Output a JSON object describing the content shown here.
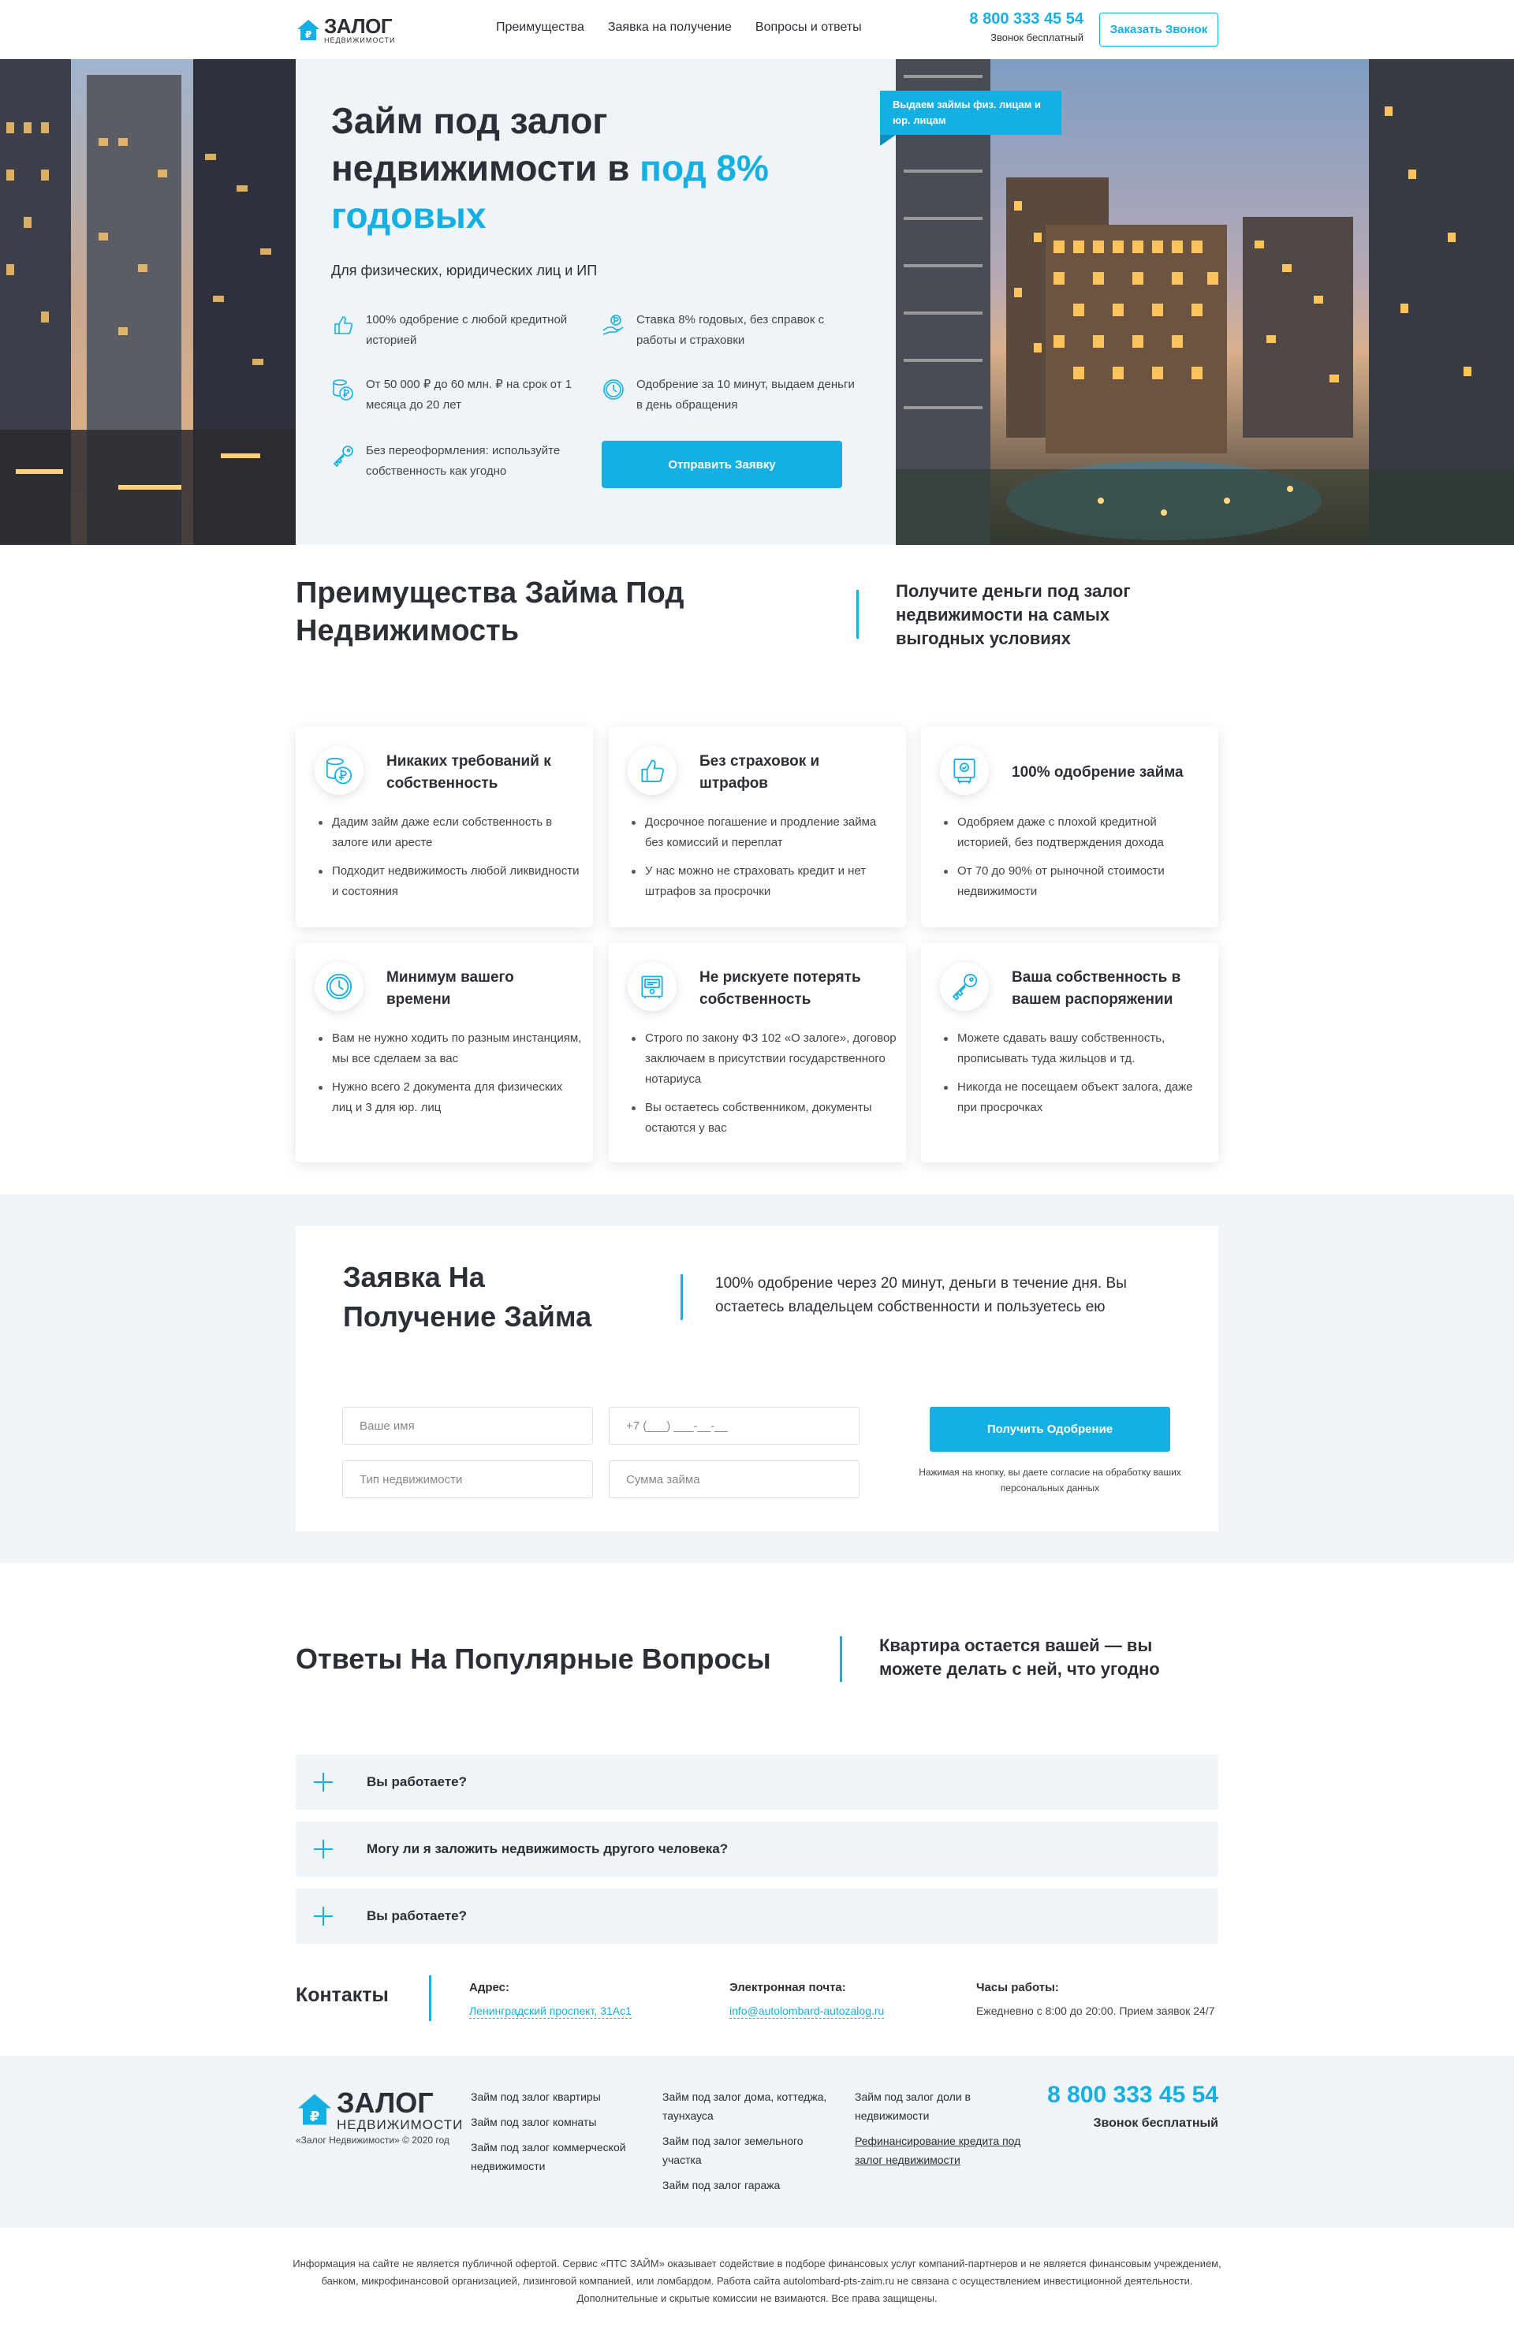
{
  "header": {
    "logo_main": "ЗАЛОГ",
    "logo_sub": "НЕДВИЖИМОСТИ",
    "nav": [
      "Преимущества",
      "Заявка на получение",
      "Вопросы и ответы"
    ],
    "phone": "8 800 333 45 54",
    "phone_note": "Звонок бесплатный",
    "call_button": "Заказать Звонок"
  },
  "hero": {
    "title_plain": "Займ под залог недвижимости в",
    "title_accent": "под 8% годовых",
    "subtitle": "Для физических, юридических лиц и ИП",
    "features": [
      {
        "icon": "thumbs-up-icon",
        "text": "100% одобрение с любой кредитной историей"
      },
      {
        "icon": "hand-coin-icon",
        "text": "Ставка 8% годовых, без справок с работы и страховки"
      },
      {
        "icon": "coins-icon",
        "text": "От 50 000 ₽ до 60 млн. ₽ на срок от 1 месяца до 20 лет"
      },
      {
        "icon": "clock-icon",
        "text": "Одобрение за 10 минут, выдаем деньги в день обращения"
      },
      {
        "icon": "key-icon",
        "text": "Без переоформления: используйте собственность как угодно"
      }
    ],
    "send_button": "Отправить Заявку",
    "flag": "Выдаем займы физ. лицам и юр. лицам"
  },
  "advantages": {
    "title": "Преимущества Займа Под Недвижимость",
    "side": "Получите деньги под залог недвижимости на самых выгодных условиях",
    "cards": [
      {
        "icon": "coins-icon",
        "title": "Никаких требований к собственность",
        "items": [
          "Дадим займ даже если собственность в залоге или аресте",
          "Подходит недвижимость любой ликвидности и состояния"
        ]
      },
      {
        "icon": "thumbs-up-icon",
        "title": "Без страховок и штрафов",
        "items": [
          "Досрочное погашение и продление займа без комиссий и переплат",
          "У нас можно не страховать кредит и нет штрафов за просрочки"
        ]
      },
      {
        "icon": "approved-document-icon",
        "title": "100% одобрение займа",
        "items": [
          "Одобряем даже с плохой кредитной историей, без подтверждения дохода",
          "От 70 до 90% от рыночной стоимости недвижимости"
        ]
      },
      {
        "icon": "clock-icon",
        "title": "Минимум вашего времени",
        "items": [
          "Вам не нужно ходить по разным инстанциям, мы все сделаем за вас",
          "Нужно всего 2 документа для физических лиц и 3 для юр. лиц"
        ]
      },
      {
        "icon": "safe-icon",
        "title": "Не рискуете потерять собственность",
        "items": [
          "Строго по закону ФЗ 102 «О залоге», договор заключаем в присутствии государственного нотариуса",
          "Вы остаетесь собственником, документы остаются у вас"
        ]
      },
      {
        "icon": "key-icon",
        "title": "Ваша собственность в вашем распоряжении",
        "items": [
          "Можете сдавать вашу собственность, прописывать туда жильцов и тд.",
          "Никогда не посещаем объект залога, даже при просрочках"
        ]
      }
    ]
  },
  "form": {
    "title": "Заявка На Получение Займа",
    "side": "100% одобрение через 20 минут, деньги в течение дня. Вы остаетесь владельцем собственности и пользуетесь ею",
    "name_placeholder": "Ваше имя",
    "phone_placeholder": "+7 (___) ___-__-__",
    "type_placeholder": "Тип недвижимости",
    "sum_placeholder": "Сумма займа",
    "submit": "Получить Одобрение",
    "note": "Нажимая на кнопку, вы даете согласие на обработку ваших персональных данных"
  },
  "faq": {
    "title": "Ответы На Популярные Вопросы",
    "side": "Квартира остается вашей — вы можете делать с ней, что угодно",
    "questions": [
      "Вы работаете?",
      "Могу ли я заложить недвижимость другого человека?",
      "Вы работаете?"
    ]
  },
  "contacts": {
    "title": "Контакты",
    "address_label": "Адрес:",
    "address": "Ленинградский проспект, 31Ас1",
    "email_label": "Электронная почта:",
    "email": "info@autolombard-autozalog.ru",
    "hours_label": "Часы работы:",
    "hours": "Ежедневно с 8:00 до 20:00. Прием заявок 24/7"
  },
  "footer": {
    "logo_main": "ЗАЛОГ",
    "logo_sub": "НЕДВИЖИМОСТИ",
    "copyright": "«Залог Недвижимости» © 2020 год",
    "col1": [
      "Займ под залог квартиры",
      "Займ под залог комнаты",
      "Займ под залог коммерческой недвижимости"
    ],
    "col2": [
      "Займ под залог дома, коттеджа, таунхауса",
      "Займ под залог земельного участка",
      "Займ под залог гаража"
    ],
    "col3": [
      "Займ под залог доли в недвижимости",
      "Рефинансирование кредита под залог недвижимости"
    ],
    "phone": "8 800 333 45 54",
    "phone_note": "Звонок бесплатный",
    "disclaimer": "Информация на сайте не является публичной офертой. Сервис «ПТС ЗАЙМ» оказывает содействие в подборе финансовых услуг компаний-партнеров и не является финансовым учреждением, банком, микрофинансовой организацией, лизинговой компанией, или ломбардом. Работа сайта autolombard-pts-zaim.ru не связана с осуществлением инвестиционной деятельности. Дополнительные и скрытые комиссии не взимаются. Все права защищены."
  },
  "colors": {
    "accent": "#14b0e3",
    "panel": "#eef4f8",
    "text": "#2c2f36"
  }
}
